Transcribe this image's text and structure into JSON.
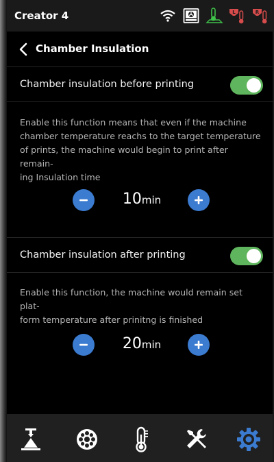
{
  "statusbar": {
    "title": "Creator 4",
    "icons": [
      "wifi-icon",
      "filter-fan-icon",
      "platform-temp-icon",
      "left-extruder-temp-icon",
      "right-extruder-temp-icon"
    ],
    "left_extruder_tag": "L",
    "right_extruder_tag": "R"
  },
  "header": {
    "title": "Chamber Insulation",
    "back_icon": "chevron-left-icon"
  },
  "before": {
    "label": "Chamber insulation before printing",
    "enabled": true,
    "desc_lines": [
      "Enable this function means that even if the machine",
      "chamber temperature reachs to the target temperature",
      "of prints, the machine would begin to print after remain-",
      "ing Insulation time"
    ],
    "value": "10",
    "unit": "min"
  },
  "after": {
    "label": "Chamber insulation after printing",
    "enabled": true,
    "desc_lines": [
      "Enable this function, the machine would remain set plat-",
      "form temperature after prinitng is finished"
    ],
    "value": "20",
    "unit": "min"
  },
  "nav": {
    "items": [
      "print-icon",
      "filament-icon",
      "temperature-icon",
      "tools-icon",
      "settings-icon"
    ],
    "active": "settings-icon"
  },
  "colors": {
    "accent": "#3b7bd0",
    "toggle_on": "#5fb55d",
    "warn_red": "#d64b4b",
    "ok_green": "#3fc24a"
  }
}
